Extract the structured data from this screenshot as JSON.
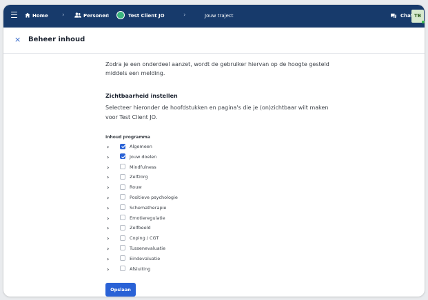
{
  "topbar": {
    "breadcrumbs": [
      {
        "label": "Home",
        "icon": "home-icon"
      },
      {
        "label": "Personen",
        "icon": "people-icon"
      },
      {
        "label": "Test Client JO",
        "icon": "client-badge-icon"
      },
      {
        "label": "Jouw traject",
        "icon": ""
      }
    ],
    "chat_label": "Chat",
    "avatar_initials": "TB",
    "colors": {
      "bar": "#173a6b",
      "accent": "#2a62d6",
      "online": "#36b24a"
    }
  },
  "header": {
    "close_glyph": "×",
    "title": "Beheer inhoud"
  },
  "intro": {
    "text": "Zodra je een onderdeel aanzet, wordt de gebruiker hiervan op de hoogte gesteld middels een melding."
  },
  "visibility": {
    "title": "Zichtbaarheid instellen",
    "description": "Selecteer hieronder de hoofdstukken en pagina's die je (on)zichtbaar wilt maken voor Test Client JO."
  },
  "program": {
    "label": "Inhoud programma",
    "items": [
      {
        "label": "Algemeen",
        "checked": true
      },
      {
        "label": "Jouw doelen",
        "checked": true
      },
      {
        "label": "Mindfulness",
        "checked": false
      },
      {
        "label": "Zelfzorg",
        "checked": false
      },
      {
        "label": "Rouw",
        "checked": false
      },
      {
        "label": "Positieve psychologie",
        "checked": false
      },
      {
        "label": "Schematherapie",
        "checked": false
      },
      {
        "label": "Emotieregulatie",
        "checked": false
      },
      {
        "label": "Zelfbeeld",
        "checked": false
      },
      {
        "label": "Coping / CGT",
        "checked": false
      },
      {
        "label": "Tussenevaluatie",
        "checked": false
      },
      {
        "label": "Eindevaluatie",
        "checked": false
      },
      {
        "label": "Afsluiting",
        "checked": false
      }
    ]
  },
  "actions": {
    "save_label": "Opslaan"
  }
}
